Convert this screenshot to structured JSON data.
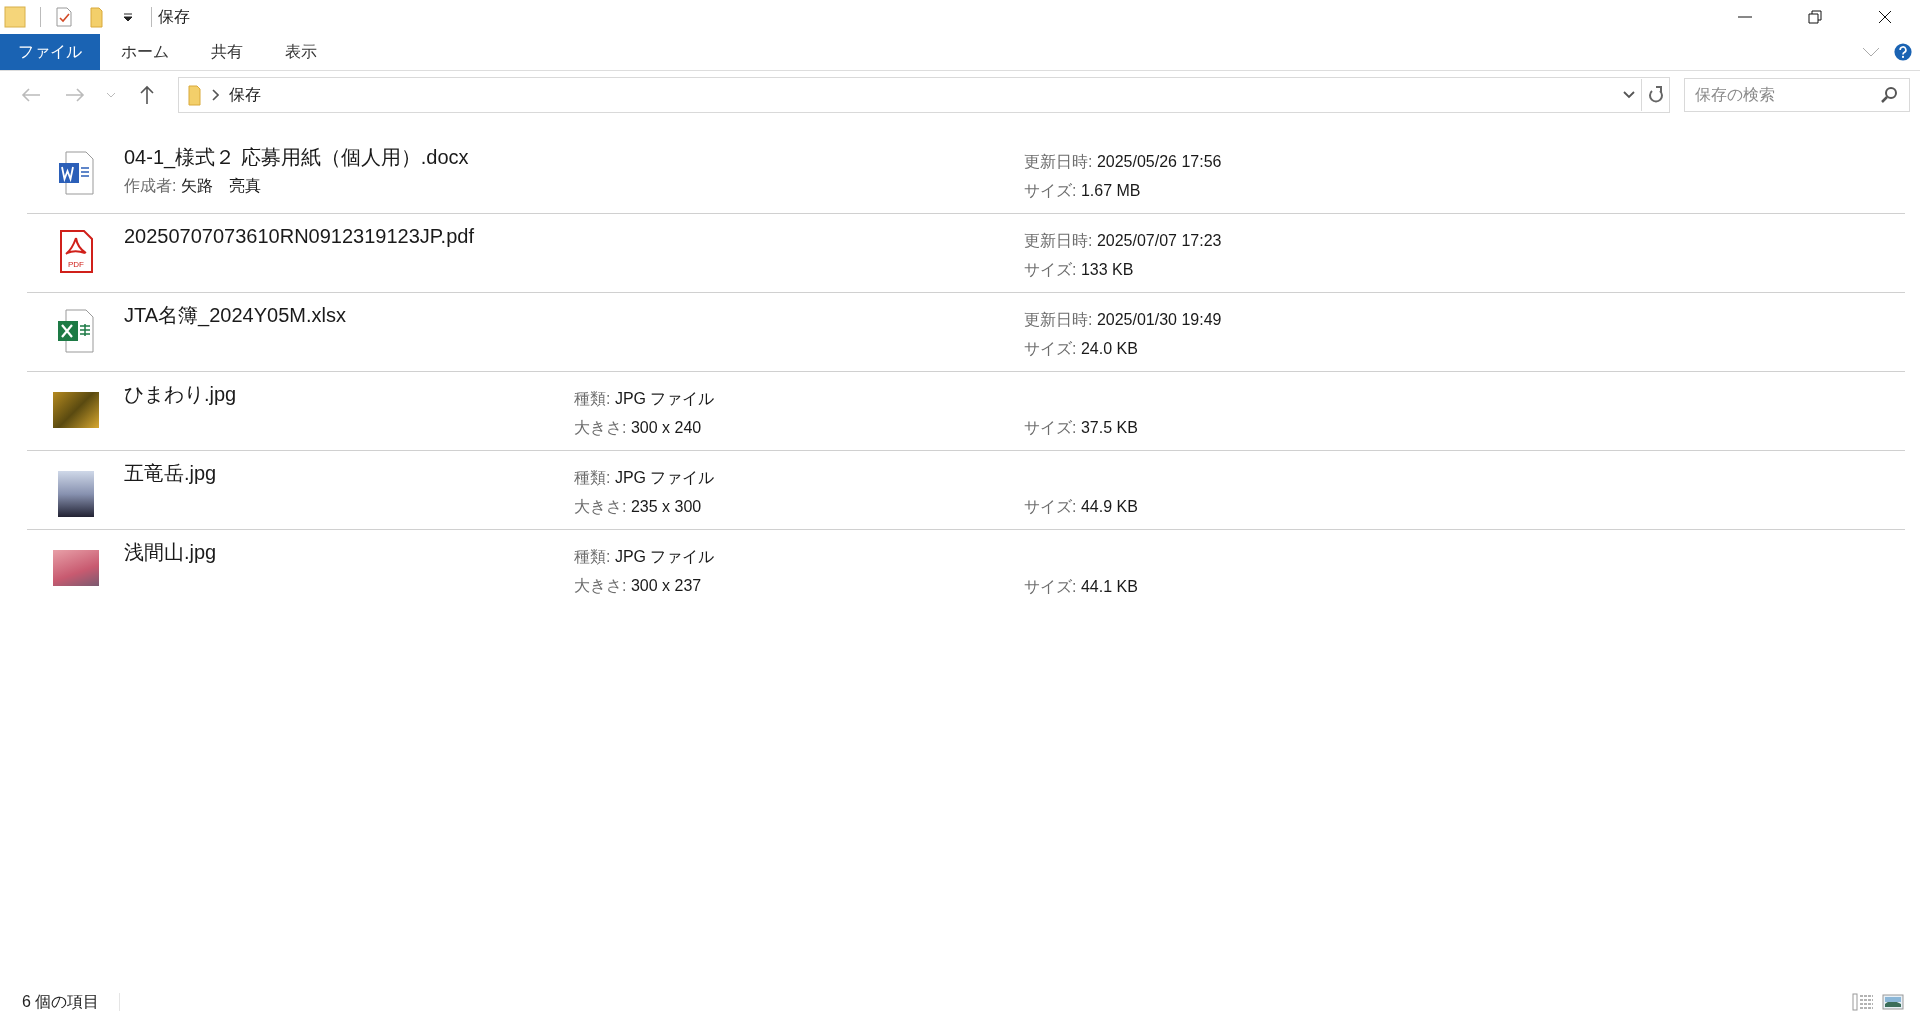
{
  "window": {
    "title": "保存"
  },
  "ribbon_tabs": [
    {
      "label": "ファイル",
      "selected": true
    },
    {
      "label": "ホーム",
      "selected": false
    },
    {
      "label": "共有",
      "selected": false
    },
    {
      "label": "表示",
      "selected": false
    }
  ],
  "address_bar": {
    "path": [
      "保存"
    ]
  },
  "search": {
    "placeholder": "保存の検索"
  },
  "items": [
    {
      "kind": "word",
      "name": "04-1_様式２ 応募用紙（個人用）.docx",
      "name_details": [
        {
          "label": "作成者:",
          "value": "矢路　亮真"
        }
      ],
      "file_details": [
        {
          "label": "更新日時:",
          "value": "2025/05/26 17:56"
        },
        {
          "label": "サイズ:",
          "value": "1.67 MB"
        }
      ]
    },
    {
      "kind": "pdf",
      "icon_text": "PDF",
      "name": "20250707073610RN0912319123JP.pdf",
      "file_details": [
        {
          "label": "更新日時:",
          "value": "2025/07/07 17:23"
        },
        {
          "label": "サイズ:",
          "value": "133 KB"
        }
      ]
    },
    {
      "kind": "excel",
      "name": "JTA名簿_2024Y05M.xlsx",
      "file_details": [
        {
          "label": "更新日時:",
          "value": "2025/01/30 19:49"
        },
        {
          "label": "サイズ:",
          "value": "24.0 KB"
        }
      ]
    },
    {
      "kind": "photo",
      "name": "ひまわり.jpg",
      "type_details": [
        {
          "label": "種類:",
          "value": "JPG ファイル"
        },
        {
          "label": "大きさ:",
          "value": "300 x 240"
        }
      ],
      "file_details": [
        {
          "label": "サイズ:",
          "value": "37.5 KB"
        }
      ]
    },
    {
      "kind": "photo",
      "name": "五竜岳.jpg",
      "type_details": [
        {
          "label": "種類:",
          "value": "JPG ファイル"
        },
        {
          "label": "大きさ:",
          "value": "235 x 300"
        }
      ],
      "file_details": [
        {
          "label": "サイズ:",
          "value": "44.9 KB"
        }
      ]
    },
    {
      "kind": "photo",
      "name": "浅間山.jpg",
      "type_details": [
        {
          "label": "種類:",
          "value": "JPG ファイル"
        },
        {
          "label": "大きさ:",
          "value": "300 x 237"
        }
      ],
      "file_details": [
        {
          "label": "サイズ:",
          "value": "44.1 KB"
        }
      ]
    }
  ],
  "status_bar": {
    "item_count": "6 個の項目"
  }
}
